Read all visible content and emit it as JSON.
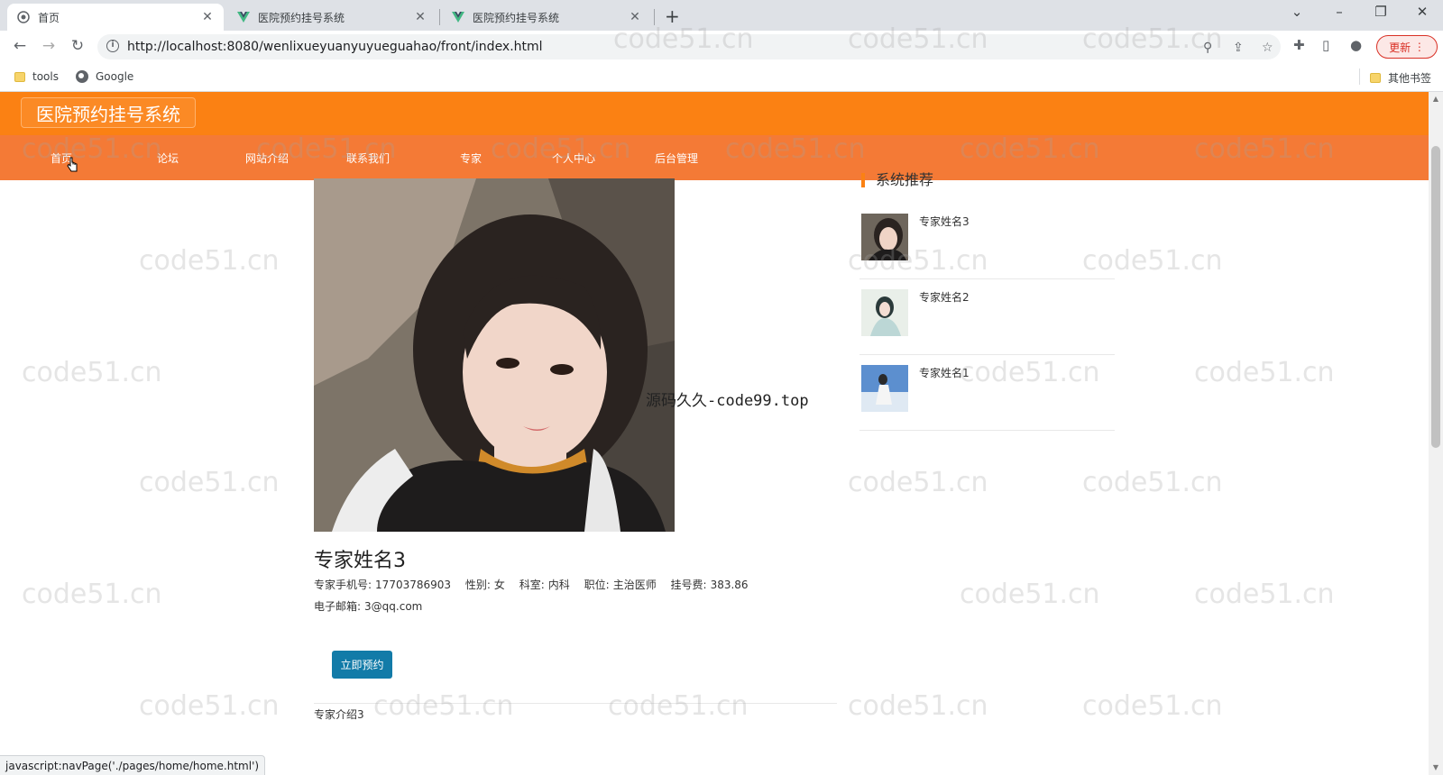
{
  "browser": {
    "tabs": [
      {
        "title": "首页",
        "active": true
      },
      {
        "title": "医院预约挂号系统",
        "active": false
      },
      {
        "title": "医院预约挂号系统",
        "active": false
      }
    ],
    "new_tab_label": "+",
    "url": "http://localhost:8080/wenlixueyuanyuyueguahao/front/index.html",
    "update_label": "更新",
    "bookmarks": [
      {
        "label": "tools",
        "icon": "folder-icon"
      },
      {
        "label": "Google",
        "icon": "globe-icon"
      }
    ],
    "other_bookmarks_label": "其他书签",
    "status_text": "javascript:navPage('./pages/home/home.html')"
  },
  "site": {
    "logo": "医院预约挂号系统",
    "nav": [
      "首页",
      "论坛",
      "网站介绍",
      "联系我们",
      "专家",
      "个人中心",
      "后台管理"
    ]
  },
  "expert": {
    "name": "专家姓名3",
    "phone_label": "专家手机号:",
    "phone": "17703786903",
    "gender_label": "性别:",
    "gender": "女",
    "dept_label": "科室:",
    "dept": "内科",
    "title_label": "职位:",
    "title": "主治医师",
    "fee_label": "挂号费:",
    "fee": "383.86",
    "email_label": "电子邮箱:",
    "email": "3@qq.com",
    "book_button": "立即预约",
    "intro": "专家介绍3"
  },
  "recommend": {
    "title": "系统推荐",
    "items": [
      {
        "name": "专家姓名3"
      },
      {
        "name": "专家姓名2"
      },
      {
        "name": "专家姓名1"
      }
    ]
  },
  "watermark_text": "code51.cn",
  "overlay_text": "源码久久-code99.top",
  "colors": {
    "header_orange": "#fb8113",
    "nav_orange": "#f47a36",
    "button_blue": "#127ba8"
  }
}
